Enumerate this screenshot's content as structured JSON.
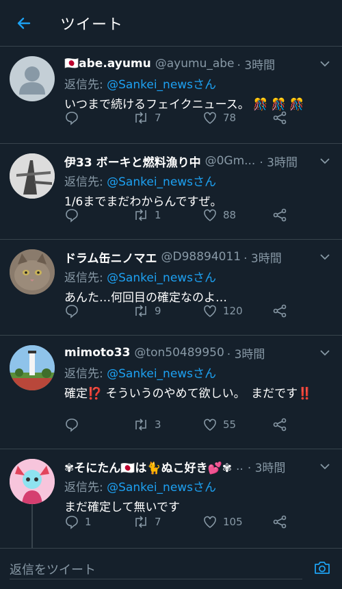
{
  "header": {
    "title": "ツイート"
  },
  "tweets": [
    {
      "name": "🇯🇵abe.ayumu",
      "handle": "@ayumu_abe",
      "time": "· 3時間",
      "reply_prefix": "返信先: ",
      "reply_to": "@Sankei_newsさん",
      "text": "いつまで続けるフェイクニュース。 🎊 🎊 🎊",
      "replies": "",
      "retweets": "7",
      "likes": "78"
    },
    {
      "name": "伊33 ボーキと燃料漁り中",
      "handle": "@0Gm...",
      "time": "· 3時間",
      "reply_prefix": "返信先: ",
      "reply_to": "@Sankei_newsさん",
      "text": "1/6までまだわからんですぜ。",
      "replies": "",
      "retweets": "1",
      "likes": "88"
    },
    {
      "name": "ドラム缶ニノマエ",
      "handle": "@D98894011",
      "time": "· 3時間",
      "reply_prefix": "返信先: ",
      "reply_to": "@Sankei_newsさん",
      "text": "あんた…何回目の確定なのよ…",
      "replies": "",
      "retweets": "9",
      "likes": "120"
    },
    {
      "name": "mimoto33",
      "handle": "@ton50489950",
      "time": "· 3時間",
      "reply_prefix": "返信先: ",
      "reply_to": "@Sankei_newsさん",
      "text": "確定⁉️ そういうのやめて欲しい。　まだです‼️",
      "replies": "",
      "retweets": "3",
      "likes": "55"
    },
    {
      "name": "✾そにたん🇯🇵は🐈ぬこ好き💕✾",
      "handle": "..",
      "time": "· 3時間",
      "reply_prefix": "返信先: ",
      "reply_to": "@Sankei_newsさん",
      "text": "まだ確定して無いです",
      "replies": "1",
      "retweets": "7",
      "likes": "105"
    }
  ],
  "composer": {
    "placeholder": "返信をツイート"
  },
  "colors": {
    "background": "#15202b",
    "accent": "#1da1f2",
    "muted": "#8899a6",
    "divider": "#38444d"
  }
}
